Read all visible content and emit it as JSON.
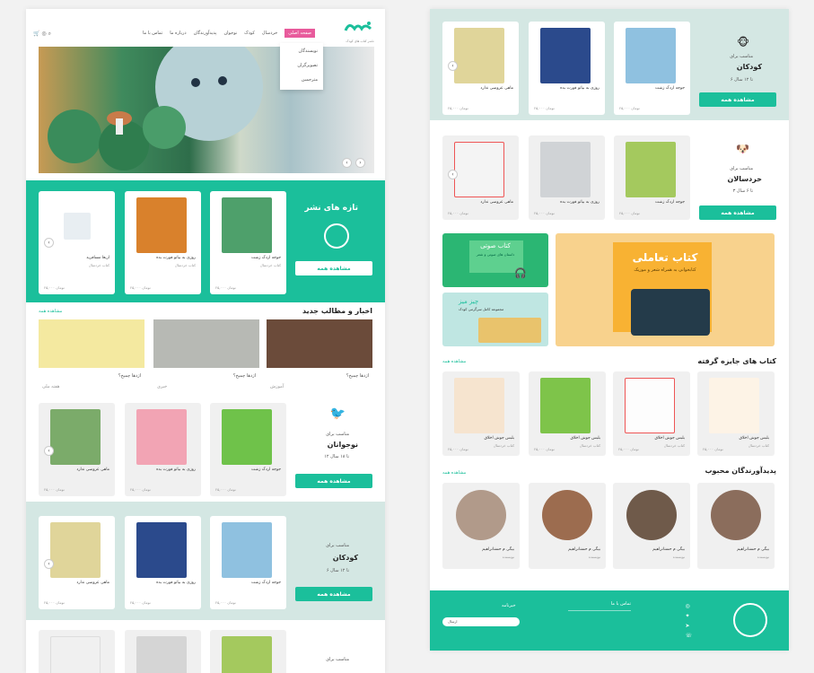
{
  "header": {
    "nav": [
      "صفحه اصلی",
      "خردسال",
      "کودک",
      "نوجوان",
      "پدیدآورندگان",
      "درباره ما",
      "تماس با ما"
    ],
    "dropdown": [
      "نویسندگان",
      "تصویرگران",
      "مترجمین"
    ],
    "tagline": "ناشر کتاب های کودک"
  },
  "newest": {
    "title": "تازه های نشر",
    "view_all": "مشاهده همه",
    "books": [
      {
        "name": "جوجه اردک زشت",
        "sub": "کتاب خردسال",
        "price": "۲۵,۰۰۰ تومان"
      },
      {
        "name": "روزی به بیاتو فورت بده",
        "sub": "کتاب خردسال",
        "price": "۲۵,۰۰۰ تومان"
      },
      {
        "name": "اربعا مسافرید",
        "sub": "کتاب خردسال",
        "price": "۲۵,۰۰۰ تومان"
      }
    ]
  },
  "news": {
    "title": "اخبار و مطالب جدید",
    "more": "مشاهده همه",
    "items": [
      {
        "q": "اژدها چمیخ؟",
        "tag": "آموزش"
      },
      {
        "q": "اژدها چمیخ؟",
        "tag": "خبری"
      },
      {
        "q": "اژدها چمیخ؟",
        "tag": "هفته ملی"
      }
    ]
  },
  "teen": {
    "label": "مناسب برای",
    "name": "نوجوانان",
    "age": "۱۲ تا ۱۸ سال",
    "view_all": "مشاهده همه",
    "books": [
      {
        "name": "جوجه اردک زشت",
        "price": "۲۵,۰۰۰ تومان"
      },
      {
        "name": "روزی به بیاتو فورت بده",
        "price": "۲۵,۰۰۰ تومان"
      },
      {
        "name": "ماهی عروسی ندارد",
        "price": "۲۵,۰۰۰ تومان"
      }
    ]
  },
  "kids": {
    "label": "مناسب برای",
    "name": "کودکان",
    "age": "۶ تا ۱۲ سال",
    "view_all": "مشاهده همه",
    "books": [
      {
        "name": "جوجه اردک زشت",
        "price": "۲۵,۰۰۰ تومان"
      },
      {
        "name": "روزی به بیاتو فورت بده",
        "price": "۲۵,۰۰۰ تومان"
      },
      {
        "name": "ماهی عروسی ندارد",
        "price": "۲۵,۰۰۰ تومان"
      }
    ]
  },
  "toddler": {
    "label": "مناسب برای",
    "name": "خردسالان",
    "age": "۳ تا ۶ سال",
    "view_all": "مشاهده همه",
    "books": [
      {
        "name": "جوجه اردک زشت",
        "price": "۲۵,۰۰۰ تومان"
      },
      {
        "name": "روزی به بیاتو فورت بده",
        "price": "۲۵,۰۰۰ تومان"
      },
      {
        "name": "ماهی عروسی ندارد",
        "price": "۲۵,۰۰۰ تومان"
      }
    ]
  },
  "promo": {
    "interactive": "کتاب تعاملی",
    "interactive_sub": "کتابخوانی به همراه شعر و موزیک",
    "audio": "کتاب صوتی",
    "audio_sub": "داستان های صوتی و شعر",
    "game": "چیز میز",
    "game_sub": "مجموعه کامل سرگرمی کودک"
  },
  "awards": {
    "title": "کتاب های جایزه گرفته",
    "more": "مشاهده همه",
    "books": [
      {
        "name": "بلبس جوش اخلاق",
        "sub": "کتاب خردسال",
        "price": "۲۵,۰۰۰ تومان"
      },
      {
        "name": "بلبس جوش اخلاق",
        "sub": "کتاب خردسال",
        "price": "۲۵,۰۰۰ تومان"
      },
      {
        "name": "بلبس جوش اخلاق",
        "sub": "کتاب خردسال",
        "price": "۲۵,۰۰۰ تومان"
      },
      {
        "name": "بلبس جوش اخلاق",
        "sub": "کتاب خردسال",
        "price": "۲۵,۰۰۰ تومان"
      }
    ]
  },
  "authors": {
    "title": "پدیدآورندگان محبوب",
    "more": "مشاهده همه",
    "people": [
      {
        "name": "بیگی م حسنانراهیم",
        "role": "نویسنده"
      },
      {
        "name": "بیگی م حسنانراهیم",
        "role": "نویسنده"
      },
      {
        "name": "بیگی م حسنانراهیم",
        "role": "نویسنده"
      },
      {
        "name": "بیگی م حسنانراهیم",
        "role": "نویسنده"
      }
    ]
  },
  "footer": {
    "contact_title": "تماس با ما",
    "newsletter": "خبرنامه",
    "btn": "ارسال"
  },
  "colors": {
    "teal": "#1bbf9b",
    "mint": "#d4e7e3",
    "pink": "#e85b9c",
    "orange": "#f8b233"
  }
}
